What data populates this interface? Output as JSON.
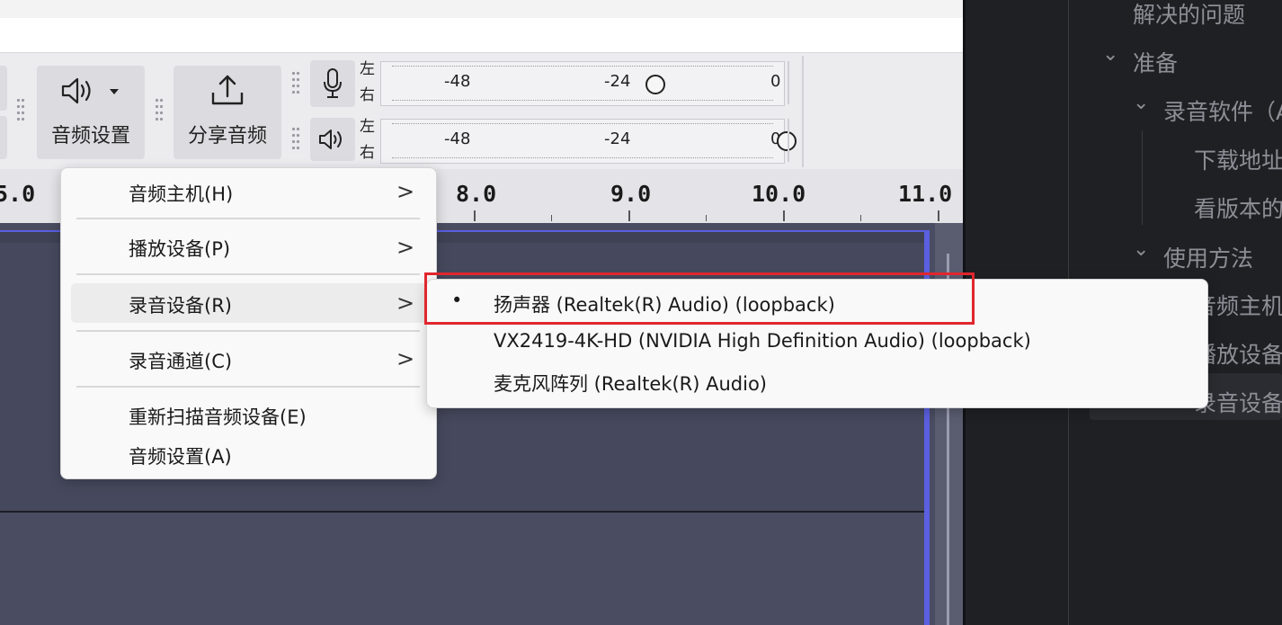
{
  "toolbar": {
    "audio_settings_label": "音频设置",
    "share_audio_label": "分享音频",
    "audio_settings_icon": "speaker-icon",
    "share_icon": "share-upload-icon",
    "dropdown_icon": "caret-down-icon"
  },
  "meters": {
    "record": {
      "icon": "microphone-icon",
      "left_label": "左",
      "right_label": "右",
      "ticks": [
        "-48",
        "-24",
        "0"
      ]
    },
    "playback": {
      "icon": "speaker-icon",
      "left_label": "左",
      "right_label": "右",
      "ticks": [
        "-48",
        "-24",
        "0"
      ]
    }
  },
  "ruler": {
    "labels": [
      "5.0",
      "8.0",
      "9.0",
      "10.0",
      "11.0"
    ]
  },
  "main_menu": {
    "items": [
      {
        "label": "音频主机(H)",
        "has_submenu": true
      },
      {
        "label": "播放设备(P)",
        "has_submenu": true
      },
      {
        "label": "录音设备(R)",
        "has_submenu": true,
        "highlighted": true
      },
      {
        "label": "录音通道(C)",
        "has_submenu": true
      },
      {
        "label": "重新扫描音频设备(E)",
        "has_submenu": false
      },
      {
        "label": "音频设置(A)",
        "has_submenu": false
      }
    ],
    "submenu_arrow": ">"
  },
  "submenu": {
    "items": [
      {
        "label": "扬声器 (Realtek(R) Audio) (loopback)",
        "selected": true
      },
      {
        "label": "VX2419-4K-HD (NVIDIA High Definition Audio) (loopback)",
        "selected": false
      },
      {
        "label": "麦克风阵列 (Realtek(R) Audio)",
        "selected": false
      }
    ],
    "selected_marker": "•",
    "highlight_color": "#e0262e"
  },
  "docs_sidebar": {
    "items": [
      {
        "label": "解决的问题",
        "level": 1,
        "chevron": false
      },
      {
        "label": "准备",
        "level": 0,
        "chevron": true
      },
      {
        "label": "录音软件（A",
        "level": 1,
        "chevron": true
      },
      {
        "label": "下载地址",
        "level": 2,
        "chevron": false
      },
      {
        "label": "看版本的",
        "level": 2,
        "chevron": false
      },
      {
        "label": "使用方法",
        "level": 1,
        "chevron": true
      },
      {
        "label": "音频主机",
        "level": 2,
        "chevron": false
      },
      {
        "label": "播放设备",
        "level": 2,
        "chevron": false
      },
      {
        "label": "录音设备",
        "level": 2,
        "chevron": false,
        "active": true
      }
    ],
    "chevron_glyph": "⌄"
  },
  "colors": {
    "track_background": "#46495d",
    "track_selection_border": "#5b5fe0",
    "sidebar_background": "#1f2024"
  }
}
